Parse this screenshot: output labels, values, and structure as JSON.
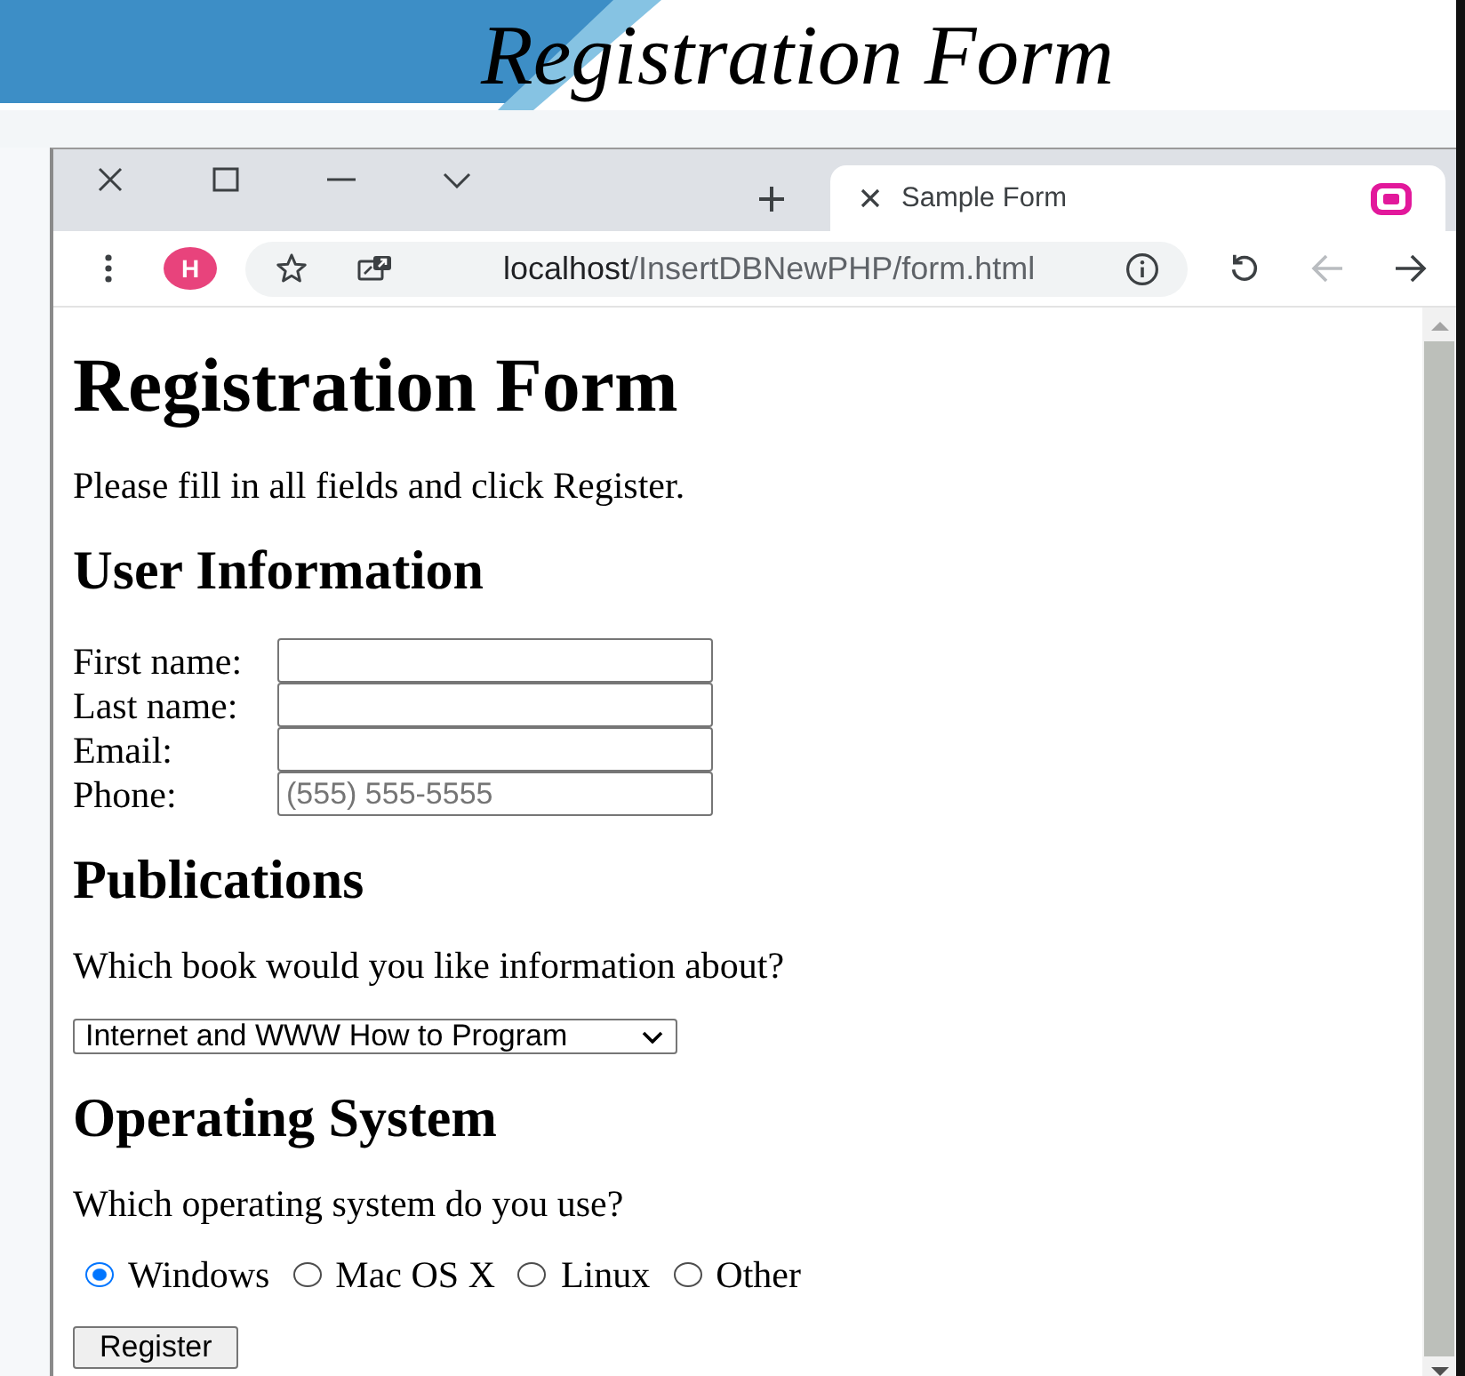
{
  "slide": {
    "title": "Registration Form"
  },
  "browser": {
    "tabs": [
      {
        "title": "Sample Form",
        "selected": true
      }
    ],
    "profile": {
      "initial": "H"
    },
    "address": {
      "host": "localhost",
      "path": "/InsertDBNewPHP/form.html"
    },
    "nav_buttons": [
      {
        "kind": "reload",
        "disabled": false
      },
      {
        "kind": "back",
        "disabled": true
      },
      {
        "kind": "forward",
        "disabled": false
      }
    ]
  },
  "page": {
    "heading": "Registration Form",
    "intro": "Please fill in all fields and click Register.",
    "sections": [
      {
        "kind": "fields",
        "heading": "User Information",
        "fields": [
          {
            "label": "First name:"
          },
          {
            "label": "Last name:"
          },
          {
            "label": "Email:"
          },
          {
            "label": "Phone:",
            "placeholder": "(555) 555-5555"
          }
        ]
      },
      {
        "kind": "select",
        "heading": "Publications",
        "prompt": "Which book would you like information about?",
        "value": "Internet and WWW How to Program"
      },
      {
        "kind": "radios",
        "heading": "Operating System",
        "prompt": "Which operating system do you use?",
        "options": [
          {
            "label": "Windows",
            "selected": true
          },
          {
            "label": "Mac OS X",
            "selected": false
          },
          {
            "label": "Linux",
            "selected": false
          },
          {
            "label": "Other",
            "selected": false
          }
        ]
      }
    ],
    "submit": "Register"
  }
}
